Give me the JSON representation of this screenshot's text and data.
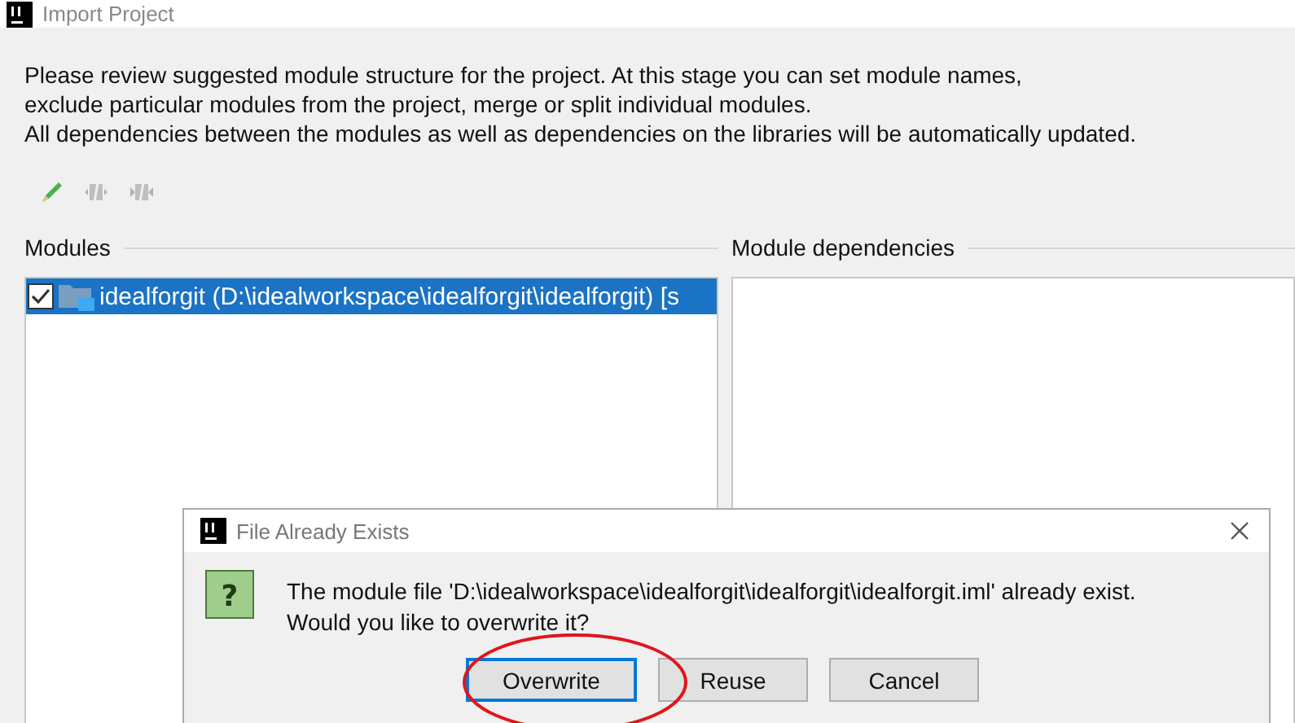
{
  "window": {
    "title": "Import Project"
  },
  "description": [
    "Please review suggested module structure for the project. At this stage you can set module names,",
    "exclude particular modules from the project, merge or split individual modules.",
    "All dependencies between the modules as well as dependencies on the libraries will be automatically updated."
  ],
  "toolbar": [
    {
      "kind": "edit",
      "disabled": false
    },
    {
      "kind": "merge",
      "disabled": true
    },
    {
      "kind": "split",
      "disabled": true
    }
  ],
  "modules": {
    "title": "Modules",
    "items": [
      {
        "label": "idealforgit (D:\\idealworkspace\\idealforgit\\idealforgit) [s",
        "checked": true,
        "selected": true
      }
    ]
  },
  "dependencies": {
    "title": "Module dependencies"
  },
  "dialog": {
    "title": "File Already Exists",
    "icon": "?",
    "message": [
      "The module file 'D:\\idealworkspace\\idealforgit\\idealforgit\\idealforgit.iml' already exist.",
      "Would you like to overwrite it?"
    ],
    "buttons": [
      {
        "label": "Overwrite",
        "selected": true
      },
      {
        "label": "Reuse",
        "selected": false
      },
      {
        "label": "Cancel",
        "selected": false
      }
    ]
  }
}
